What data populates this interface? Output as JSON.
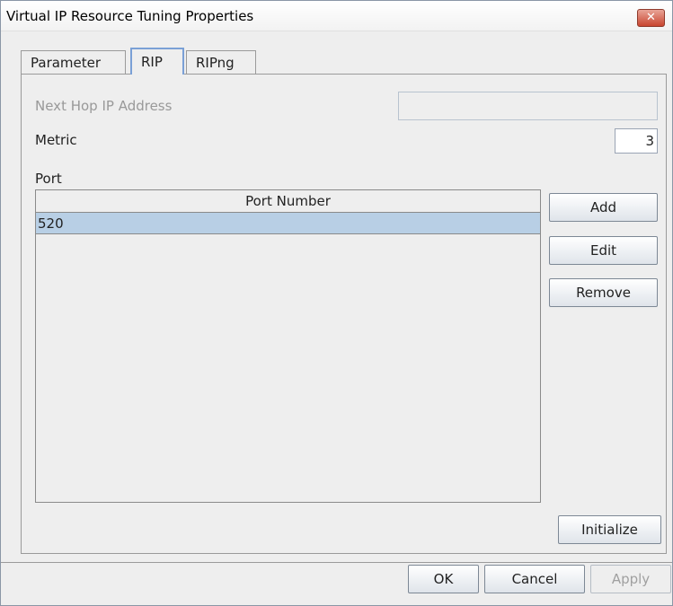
{
  "window": {
    "title": "Virtual IP Resource Tuning Properties",
    "close_glyph": "✕"
  },
  "tabs": [
    {
      "label": "Parameter"
    },
    {
      "label": "RIP"
    },
    {
      "label": "RIPng"
    }
  ],
  "form": {
    "next_hop_label": "Next Hop IP Address",
    "next_hop_value": "",
    "metric_label": "Metric",
    "metric_value": "3",
    "port_label": "Port"
  },
  "table": {
    "header": "Port Number",
    "rows": [
      "520"
    ]
  },
  "side_buttons": {
    "add": "Add",
    "edit": "Edit",
    "remove": "Remove",
    "initialize": "Initialize"
  },
  "footer": {
    "ok": "OK",
    "cancel": "Cancel",
    "apply": "Apply"
  }
}
